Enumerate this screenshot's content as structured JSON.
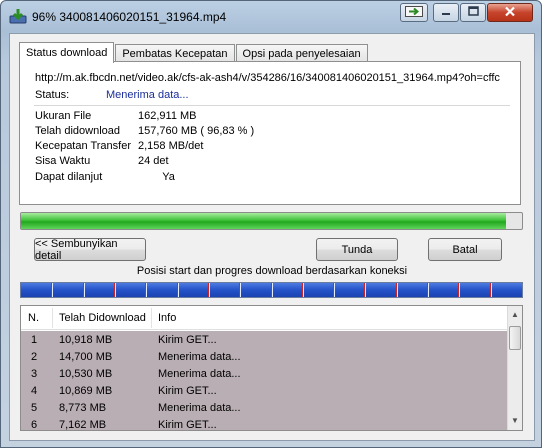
{
  "window": {
    "title": "96% 340081406020151_31964.mp4",
    "icons": {
      "app": "idm-download-icon",
      "extra": "restore-arrow-icon",
      "minimize": "minimize-icon",
      "maximize": "maximize-icon",
      "close": "close-icon"
    }
  },
  "tabs": [
    {
      "label": "Status download",
      "active": true
    },
    {
      "label": "Pembatas Kecepatan",
      "active": false
    },
    {
      "label": "Opsi pada penyelesaian",
      "active": false
    }
  ],
  "details": {
    "url": "http://m.ak.fbcdn.net/video.ak/cfs-ak-ash4/v/354286/16/340081406020151_31964.mp4?oh=cffc",
    "status_label": "Status:",
    "status_value": "Menerima data...",
    "rows": [
      {
        "label": "Ukuran File",
        "value": "162,911  MB"
      },
      {
        "label": "Telah didownload",
        "value": "157,760  MB  ( 96,83 % )"
      },
      {
        "label": "Kecepatan Transfer",
        "value": "2,158  MB/det"
      },
      {
        "label": "Sisa Waktu",
        "value": "24 det"
      },
      {
        "label": "Dapat dilanjut",
        "value": "        Ya"
      }
    ]
  },
  "progress": {
    "fraction": 0.9683,
    "color": "#2db52a"
  },
  "buttons": {
    "hide_details": "<< Sembunyikan detail",
    "pause": "Tunda",
    "cancel": "Batal"
  },
  "connections": {
    "caption": "Posisi start dan progres download berdasarkan koneksi",
    "segments": 16,
    "completed_fraction": 0.97
  },
  "list": {
    "headers": {
      "num": "N.",
      "downloaded": "Telah Didownload",
      "info": "Info"
    },
    "rows": [
      {
        "num": "1",
        "downloaded": "10,918  MB",
        "info": "Kirim GET..."
      },
      {
        "num": "2",
        "downloaded": "14,700  MB",
        "info": "Menerima data..."
      },
      {
        "num": "3",
        "downloaded": "10,530  MB",
        "info": "Menerima data..."
      },
      {
        "num": "4",
        "downloaded": "10,869  MB",
        "info": "Kirim GET..."
      },
      {
        "num": "5",
        "downloaded": "8,773  MB",
        "info": "Menerima data..."
      },
      {
        "num": "6",
        "downloaded": "7,162  MB",
        "info": "Kirim GET..."
      }
    ]
  }
}
